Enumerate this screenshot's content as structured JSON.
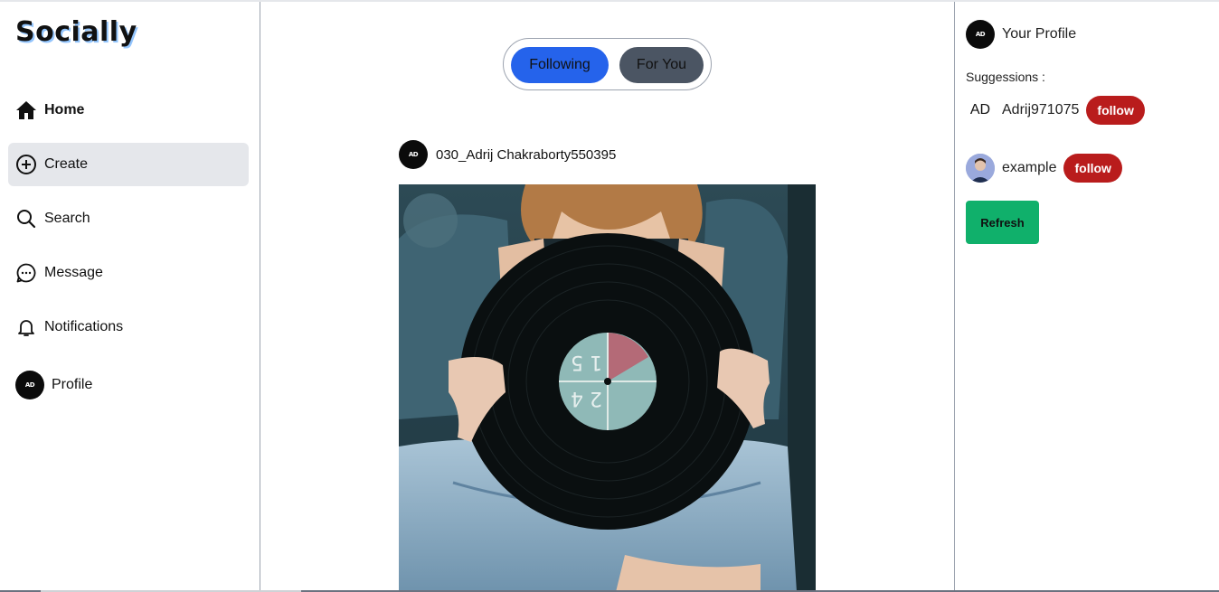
{
  "app": {
    "logo": "Socially"
  },
  "sidebar": {
    "items": [
      {
        "label": "Home",
        "icon": "home-icon",
        "bold": true
      },
      {
        "label": "Create",
        "icon": "plus-circle-icon",
        "active": true
      },
      {
        "label": "Search",
        "icon": "search-icon"
      },
      {
        "label": "Message",
        "icon": "message-bubble-icon"
      },
      {
        "label": "Notifications",
        "icon": "bell-icon"
      },
      {
        "label": "Profile",
        "icon": "avatar"
      }
    ]
  },
  "feed": {
    "tabs": {
      "following": "Following",
      "for_you": "For You"
    },
    "post": {
      "username": "030_Adrij Chakraborty550395",
      "image": "woman holding vinyl record"
    }
  },
  "right_panel": {
    "your_profile": "Your Profile",
    "suggestions_title": "Suggessions :",
    "suggestions": [
      {
        "name": "Adrij971075",
        "button": "follow"
      },
      {
        "name": "example",
        "button": "follow"
      }
    ],
    "refresh_label": "Refresh"
  },
  "colors": {
    "following_tab": "#2563eb",
    "for_you_tab": "#4b5563",
    "follow_button": "#b91c1c",
    "refresh_button": "#10b06b",
    "active_nav": "#e5e7eb"
  }
}
